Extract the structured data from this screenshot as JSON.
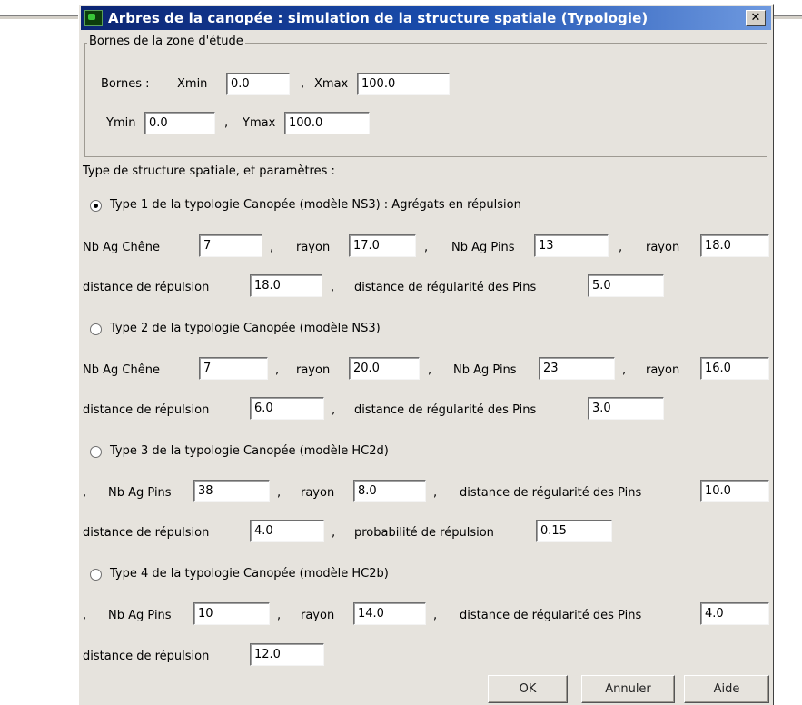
{
  "window": {
    "title": "Arbres de la canopée : simulation de la structure spatiale (Typologie)",
    "close_label": "✕"
  },
  "bounds": {
    "legend": "Bornes de la zone d'étude",
    "label": "Bornes :",
    "xmin_label": "Xmin",
    "xmin": "0.0",
    "sep1": ",",
    "xmax_label": "Xmax",
    "xmax": "100.0",
    "ymin_label": "Ymin",
    "ymin": "0.0",
    "sep2": ",",
    "ymax_label": "Ymax",
    "ymax": "100.0"
  },
  "section_label": "Type de structure spatiale, et paramètres :",
  "type1": {
    "label": "Type 1 de la typologie Canopée (modèle NS3) : Agrégats en répulsion",
    "selected": true,
    "nb_chene_label": "Nb Ag Chêne",
    "nb_chene": "7",
    "c1": ",",
    "rayon1_label": "rayon",
    "rayon1": "17.0",
    "c2": ",",
    "nb_pins_label": "Nb Ag Pins",
    "nb_pins": "13",
    "c3": ",",
    "rayon2_label": "rayon",
    "rayon2": "18.0",
    "repulsion_label": "distance de répulsion",
    "repulsion": "18.0",
    "c4": ",",
    "regularite_label": "distance de régularité des Pins",
    "regularite": "5.0"
  },
  "type2": {
    "label": "Type 2 de la typologie Canopée (modèle NS3)",
    "selected": false,
    "nb_chene_label": "Nb Ag Chêne",
    "nb_chene": "7",
    "c1": ",",
    "rayon1_label": "rayon",
    "rayon1": "20.0",
    "c2": ",",
    "nb_pins_label": "Nb Ag Pins",
    "nb_pins": "23",
    "c3": ",",
    "rayon2_label": "rayon",
    "rayon2": "16.0",
    "repulsion_label": "distance de répulsion",
    "repulsion": "6.0",
    "c4": ",",
    "regularite_label": "distance de régularité des Pins",
    "regularite": "3.0"
  },
  "type3": {
    "label": "Type 3 de la typologie Canopée (modèle HC2d)",
    "selected": false,
    "c0": ",",
    "nb_pins_label": "Nb Ag Pins",
    "nb_pins": "38",
    "c1": ",",
    "rayon_label": "rayon",
    "rayon": "8.0",
    "c2": ",",
    "regularite_label": "distance de régularité des Pins",
    "regularite": "10.0",
    "repulsion_label": "distance de répulsion",
    "repulsion": "4.0",
    "c3": ",",
    "proba_label": "probabilité de répulsion",
    "proba": "0.15"
  },
  "type4": {
    "label": "Type 4 de la typologie Canopée (modèle HC2b)",
    "selected": false,
    "c0": ",",
    "nb_pins_label": "Nb Ag Pins",
    "nb_pins": "10",
    "c1": ",",
    "rayon_label": "rayon",
    "rayon": "14.0",
    "c2": ",",
    "regularite_label": "distance de régularité des Pins",
    "regularite": "4.0",
    "repulsion_label": "distance de répulsion",
    "repulsion": "12.0"
  },
  "buttons": {
    "ok": "OK",
    "cancel": "Annuler",
    "help": "Aide"
  },
  "colors": {
    "titlebar_start": "#0b2472",
    "titlebar_end": "#6f9ae0",
    "dialog_bg": "#e6e3dd"
  },
  "icons": {
    "app": "app-icon",
    "close": "close-icon"
  }
}
